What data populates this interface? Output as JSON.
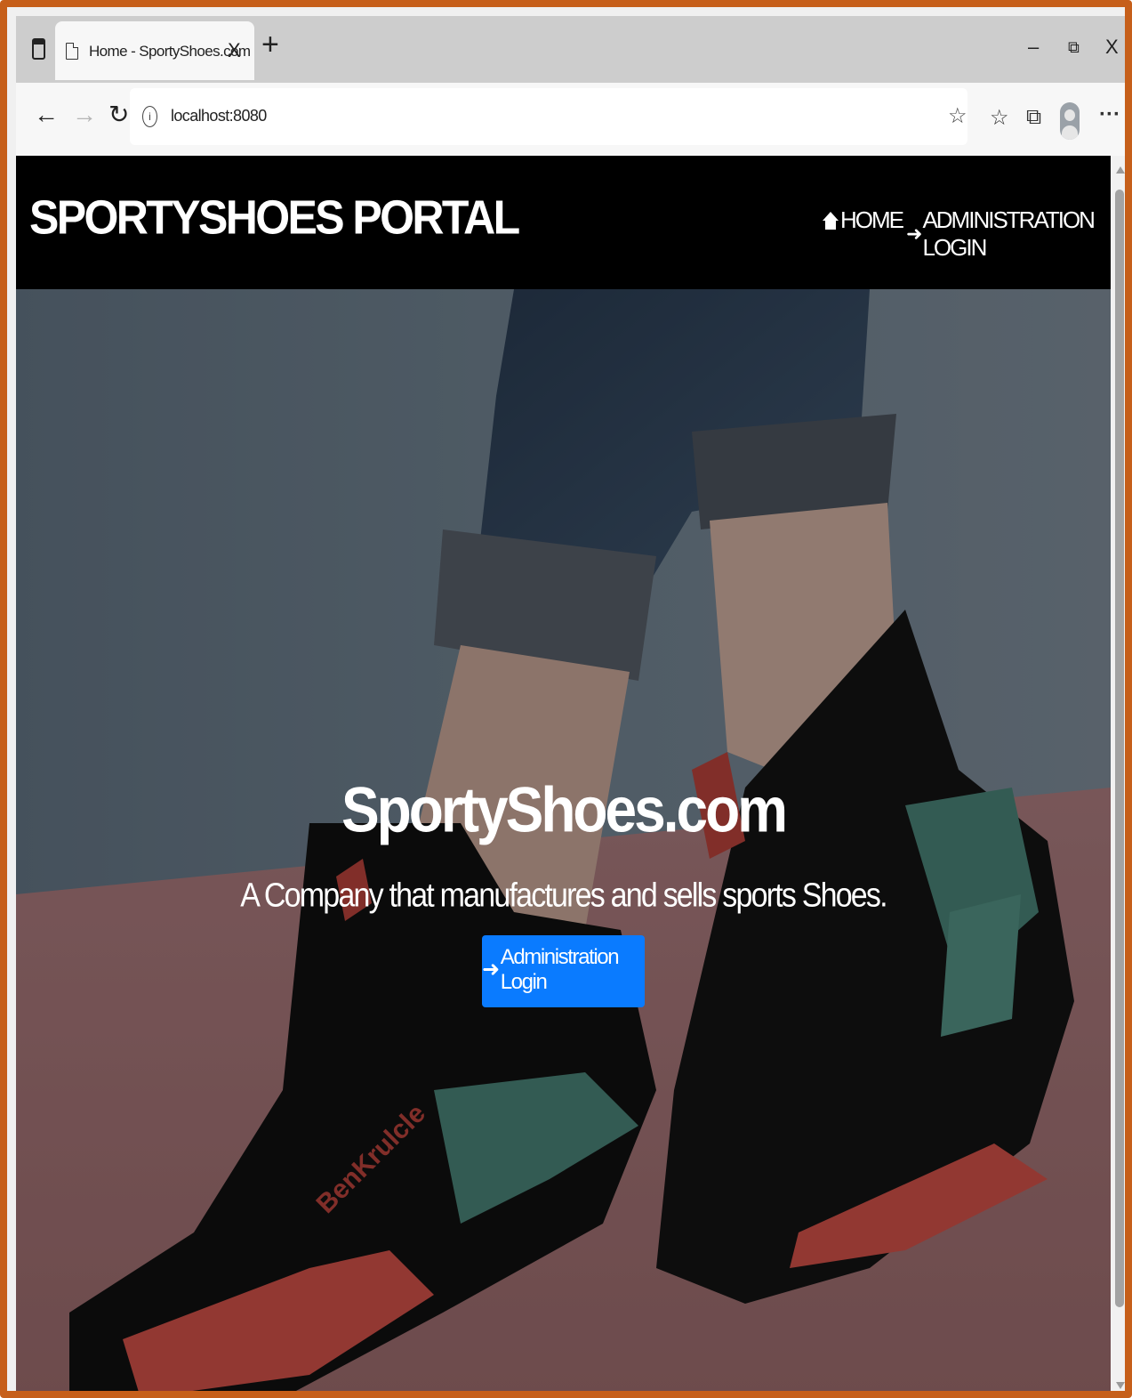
{
  "browser": {
    "tab_title": "Home - SportyShoes.com",
    "tab_close": "X",
    "new_tab": "+",
    "minimize": "–",
    "restore": "⧉",
    "close": "X",
    "url": "localhost:8080",
    "more": "···",
    "back": "←",
    "forward": "→",
    "refresh": "↻"
  },
  "site": {
    "brand": "SPORTYSHOES PORTAL",
    "nav": {
      "home": "HOME",
      "admin_login": "ADMINISTRATION LOGIN"
    }
  },
  "hero": {
    "title": "SportyShoes.com",
    "subtitle": "A Company that manufactures and sells sports Shoes.",
    "button": "Administration Login",
    "shoe_brand_text": "BenKrulcle"
  },
  "icons": {
    "tab_actions": "tab-actions-icon",
    "page": "page-icon",
    "info": "info-icon",
    "favorite": "add-favorite-icon",
    "favorites_list": "favorites-icon",
    "collections": "collections-icon",
    "profile": "profile-avatar-icon",
    "home": "home-icon",
    "login": "sign-in-icon"
  },
  "colors": {
    "frame_border": "#c65f1a",
    "navbar_bg": "#000000",
    "button_bg": "#0a7bff"
  }
}
